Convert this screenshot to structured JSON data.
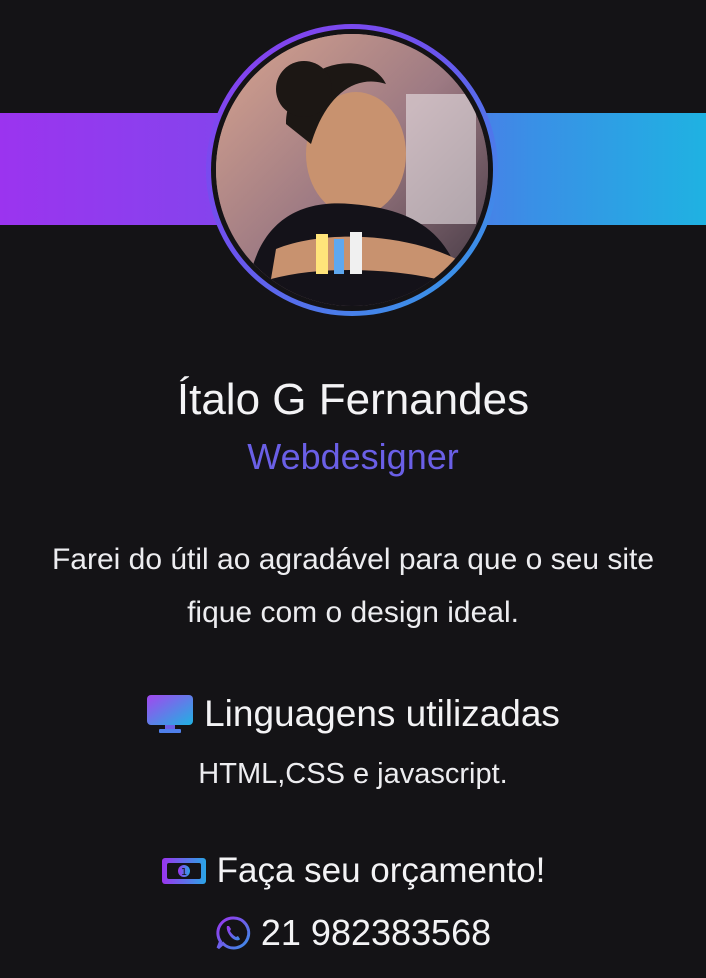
{
  "profile": {
    "name": "Ítalo G Fernandes",
    "role": "Webdesigner",
    "description": "Farei do útil ao agradável para que o seu site fique com o design ideal."
  },
  "languages": {
    "title": "Linguagens utilizadas",
    "text": "HTML,CSS e javascript.",
    "icon": "monitor-icon"
  },
  "budget": {
    "label": "Faça seu orçamento!",
    "icon": "money-icon"
  },
  "contact": {
    "phone": "21 982383568",
    "icon": "whatsapp-icon"
  },
  "colors": {
    "background": "#141316",
    "accent_purple": "#9b34ef",
    "accent_blue": "#1fb2e2",
    "role_text": "#6a5fe6"
  }
}
